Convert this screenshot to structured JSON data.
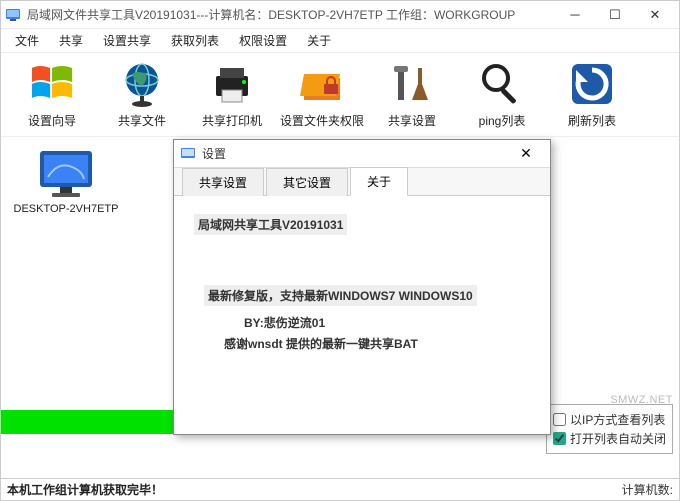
{
  "titlebar": {
    "text": "局域网文件共享工具V20191031---计算机名：DESKTOP-2VH7ETP  工作组：WORKGROUP"
  },
  "menu": {
    "items": [
      "文件",
      "共享",
      "设置共享",
      "获取列表",
      "权限设置",
      "关于"
    ]
  },
  "toolbar": {
    "items": [
      {
        "label": "设置向导",
        "name": "wizard"
      },
      {
        "label": "共享文件",
        "name": "share-files"
      },
      {
        "label": "共享打印机",
        "name": "share-printer"
      },
      {
        "label": "设置文件夹权限",
        "name": "folder-perm"
      },
      {
        "label": "共享设置",
        "name": "share-settings"
      },
      {
        "label": "ping列表",
        "name": "ping-list"
      },
      {
        "label": "刷新列表",
        "name": "refresh-list"
      }
    ]
  },
  "desktop": {
    "computer_label": "DESKTOP-2VH7ETP"
  },
  "dialog": {
    "title": "设置",
    "tabs": [
      "共享设置",
      "其它设置",
      "关于"
    ],
    "active_tab": "关于",
    "about": {
      "line1": "局域网共享工具V20191031",
      "line2": "最新修复版，支持最新WINDOWS7 WINDOWS10",
      "line3": "BY:悲伤逆流01",
      "line4": "感谢wnsdt 提供的最新一键共享BAT"
    }
  },
  "options": {
    "ip_view": "以IP方式查看列表",
    "auto_close": "打开列表自动关闭"
  },
  "status": {
    "left": "本机工作组计算机获取完毕！",
    "right": "计算机数:"
  },
  "watermark": "SMWZ.NET"
}
